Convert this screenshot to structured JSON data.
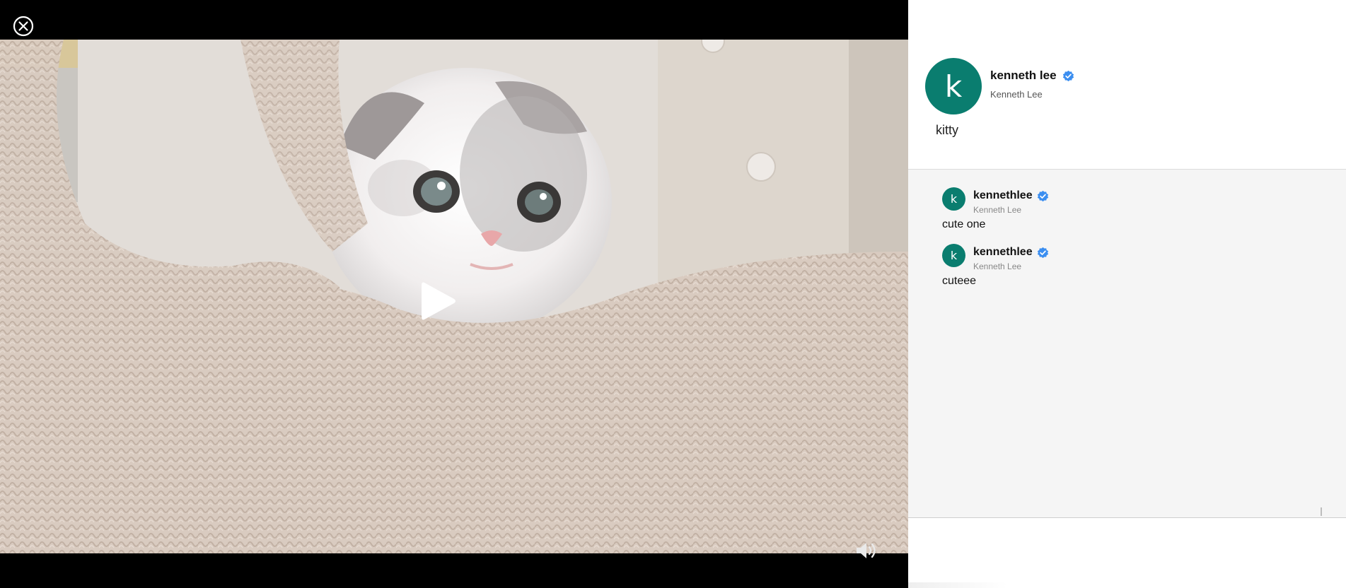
{
  "icons": {
    "close": "close-circle-icon",
    "play": "play-icon",
    "volume": "volume-icon",
    "verified": "verified-badge-icon"
  },
  "colors": {
    "avatar_bg": "#0a7d6f",
    "verified_blue": "#3b8ef0",
    "viewer_bg": "#000000",
    "comments_bg": "#f5f5f5"
  },
  "post": {
    "avatar_letter": "k",
    "author_name": "kenneth lee",
    "author_subtitle": "Kenneth Lee",
    "caption": "kitty"
  },
  "comments": [
    {
      "avatar_letter": "k",
      "username": "kennethlee",
      "display_name": "Kenneth Lee",
      "text": "cute one"
    },
    {
      "avatar_letter": "k",
      "username": "kennethlee",
      "display_name": "Kenneth Lee",
      "text": "cuteee"
    }
  ]
}
